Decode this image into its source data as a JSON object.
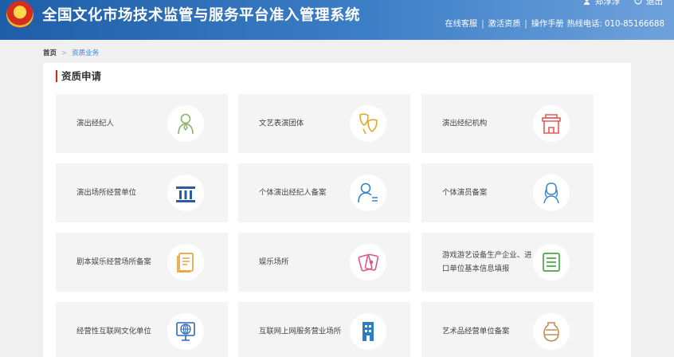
{
  "header": {
    "title": "全国文化市场技术监管与服务平台准入管理系统",
    "user_name": "郑淳淳",
    "logout": "退出",
    "links": [
      "在线客服",
      "激活资质",
      "操作手册",
      "热线电话: 010-85166688"
    ]
  },
  "breadcrumb": {
    "home": "首页",
    "current": "资质业务"
  },
  "section_title": "资质申请",
  "cards": [
    {
      "label": "演出经纪人",
      "icon": "person-icon",
      "color": "#8db46a"
    },
    {
      "label": "文艺表演团体",
      "icon": "drama-masks-icon",
      "color": "#e5a728"
    },
    {
      "label": "演出经纪机构",
      "icon": "building-gate-icon",
      "color": "#e05a52"
    },
    {
      "label": "演出场所经营单位",
      "icon": "venue-icon",
      "color": "#2c5b9e"
    },
    {
      "label": "个体演出经纪人备案",
      "icon": "person-list-icon",
      "color": "#2f86c6"
    },
    {
      "label": "个体演员备案",
      "icon": "performer-icon",
      "color": "#3c87c9"
    },
    {
      "label": "剧本娱乐经营场所备案",
      "icon": "book-icon",
      "color": "#e8a43b"
    },
    {
      "label": "娱乐场所",
      "icon": "game-cards-icon",
      "color": "#d9588a"
    },
    {
      "label": "游戏游艺设备生产企业、进口单位基本信息填报",
      "icon": "list-board-icon",
      "color": "#49a84a"
    },
    {
      "label": "经营性互联网文化单位",
      "icon": "globe-computer-icon",
      "color": "#2c6ab3"
    },
    {
      "label": "互联网上网服务营业场所",
      "icon": "office-building-icon",
      "color": "#2c7ec4"
    },
    {
      "label": "艺术品经营单位备案",
      "icon": "vase-icon",
      "color": "#c08d5a"
    }
  ]
}
